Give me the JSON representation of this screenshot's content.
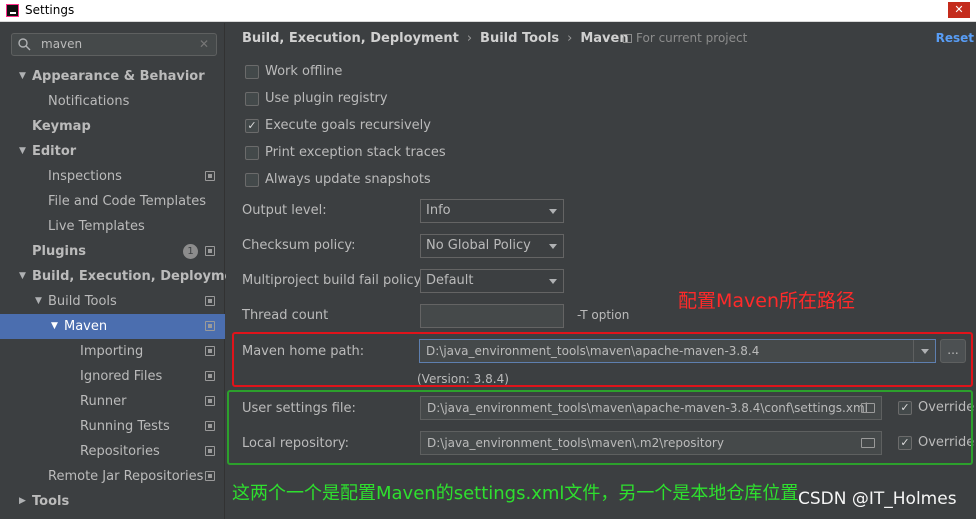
{
  "window": {
    "title": "Settings",
    "close_glyph": "✕"
  },
  "sidebar": {
    "search_value": "maven",
    "search_clear_glyph": "✕",
    "items": [
      {
        "label": "Appearance & Behavior",
        "arrow": "▼",
        "bold": true
      },
      {
        "label": "Notifications"
      },
      {
        "label": "Keymap",
        "bold": true
      },
      {
        "label": "Editor",
        "arrow": "▼",
        "bold": true
      },
      {
        "label": "Inspections"
      },
      {
        "label": "File and Code Templates"
      },
      {
        "label": "Live Templates"
      },
      {
        "label": "Plugins",
        "bold": true,
        "badge": "1"
      },
      {
        "label": "Build, Execution, Deployment",
        "arrow": "▼",
        "bold": true
      },
      {
        "label": "Build Tools",
        "arrow": "▼"
      },
      {
        "label": "Maven",
        "arrow": "▼",
        "selected": true
      },
      {
        "label": "Importing"
      },
      {
        "label": "Ignored Files"
      },
      {
        "label": "Runner"
      },
      {
        "label": "Running Tests"
      },
      {
        "label": "Repositories"
      },
      {
        "label": "Remote Jar Repositories"
      },
      {
        "label": "Tools",
        "arrow": "▶",
        "bold": true
      }
    ]
  },
  "header": {
    "breadcrumb": [
      "Build, Execution, Deployment",
      "Build Tools",
      "Maven"
    ],
    "breadcrumb_sep": "›",
    "for_project": "For current project",
    "reset": "Reset"
  },
  "options": {
    "work_offline": {
      "label": "Work offline",
      "checked": false
    },
    "plugin_registry": {
      "label": "Use plugin registry",
      "checked": false
    },
    "execute_goals": {
      "label": "Execute goals recursively",
      "checked": true
    },
    "print_traces": {
      "label": "Print exception stack traces",
      "checked": false
    },
    "update_snapshots": {
      "label": "Always update snapshots",
      "checked": false
    },
    "check_glyph": "✓"
  },
  "form": {
    "output_level": {
      "label": "Output level:",
      "value": "Info"
    },
    "checksum_policy": {
      "label": "Checksum policy:",
      "value": "No Global Policy"
    },
    "fail_policy": {
      "label": "Multiproject build fail policy:",
      "value": "Default"
    },
    "thread_count": {
      "label": "Thread count",
      "value": "",
      "hint": "-T option"
    },
    "maven_home": {
      "label": "Maven home path:",
      "value": "D:\\java_environment_tools\\maven\\apache-maven-3.8.4",
      "browse": "...",
      "version": "(Version: 3.8.4)"
    },
    "user_settings": {
      "label": "User settings file:",
      "value": "D:\\java_environment_tools\\maven\\apache-maven-3.8.4\\conf\\settings.xml",
      "override": "Override",
      "override_checked": true
    },
    "local_repo": {
      "label": "Local repository:",
      "value": "D:\\java_environment_tools\\maven\\.m2\\repository",
      "override": "Override",
      "override_checked": true
    }
  },
  "annotations": {
    "red_note": "配置Maven所在路径",
    "green_note": "这两个一个是配置Maven的settings.xml文件，另一个是本地仓库位置",
    "watermark": "CSDN @IT_Holmes",
    "red_color": "#e0131a",
    "green_color": "#2ca02c"
  },
  "colors": {
    "selection": "#4b6eaf",
    "background": "#3c3f41",
    "link": "#589df6"
  }
}
